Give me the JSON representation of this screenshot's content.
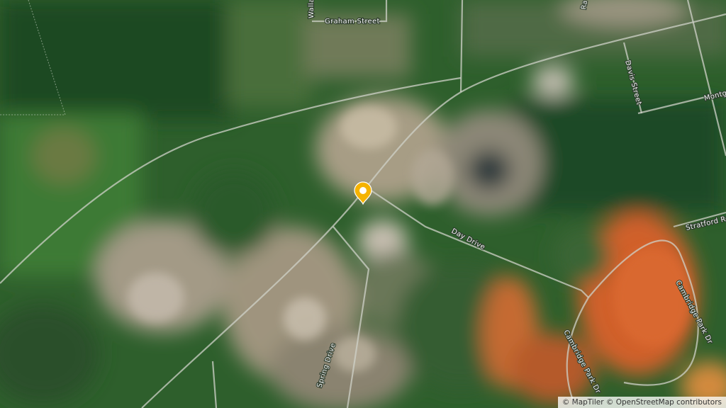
{
  "map": {
    "type": "satellite",
    "streets": {
      "graham": "Graham Street",
      "wallace": "Walla",
      "davis": "Davis Street",
      "montg": "Montg",
      "stratford": "Stratford Ro",
      "day": "Day Drive",
      "spring": "Spring Drive",
      "cambridge1": "Cambridge Park Dr",
      "cambridge2": "Cambridge Park Dr",
      "rail": "Ra"
    },
    "marker": {
      "icon": "location-pin-icon",
      "color": "#f5b301"
    }
  },
  "attribution": {
    "maptiler": "© MapTiler",
    "osm": "© OpenStreetMap contributors"
  }
}
